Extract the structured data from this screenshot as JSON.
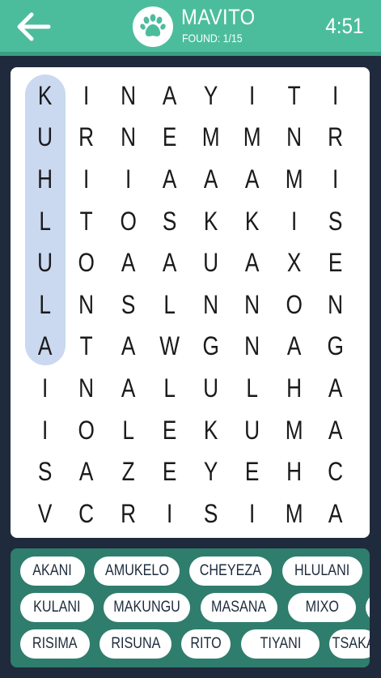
{
  "header": {
    "title": "MAVITO",
    "found_label": "FOUND: 1/15",
    "timer": "4:51",
    "accent_color": "#4cbd9c",
    "back_icon": "arrow-left-icon",
    "badge_icon": "paw-icon"
  },
  "board": {
    "grid": [
      [
        "K",
        "I",
        "N",
        "A",
        "Y",
        "I",
        "T",
        "I"
      ],
      [
        "U",
        "R",
        "N",
        "E",
        "M",
        "M",
        "N",
        "R"
      ],
      [
        "H",
        "I",
        "I",
        "A",
        "A",
        "A",
        "M",
        "I"
      ],
      [
        "L",
        "T",
        "O",
        "S",
        "K",
        "K",
        "I",
        "S"
      ],
      [
        "U",
        "O",
        "A",
        "A",
        "U",
        "A",
        "X",
        "E"
      ],
      [
        "L",
        "N",
        "S",
        "L",
        "N",
        "N",
        "O",
        "N"
      ],
      [
        "A",
        "T",
        "A",
        "W",
        "G",
        "N",
        "A",
        "G"
      ],
      [
        "I",
        "N",
        "A",
        "L",
        "U",
        "L",
        "H",
        "A"
      ],
      [
        "I",
        "O",
        "L",
        "E",
        "K",
        "U",
        "M",
        "A"
      ],
      [
        "S",
        "A",
        "Z",
        "E",
        "Y",
        "E",
        "H",
        "C"
      ],
      [
        "V",
        "C",
        "R",
        "I",
        "S",
        "I",
        "M",
        "A"
      ]
    ],
    "found_word": "KUHLULA",
    "highlight_color": "#cad8f0"
  },
  "words": {
    "rows": [
      [
        "AKANI",
        "AMUKELO",
        "CHEYEZA",
        "HLULANI",
        "K"
      ],
      [
        "KULANI",
        "MAKUNGU",
        "MASANA",
        "MIXO",
        "N"
      ],
      [
        "RISIMA",
        "RISUNA",
        "RITO",
        "TIYANI",
        "TSAKA"
      ]
    ]
  }
}
